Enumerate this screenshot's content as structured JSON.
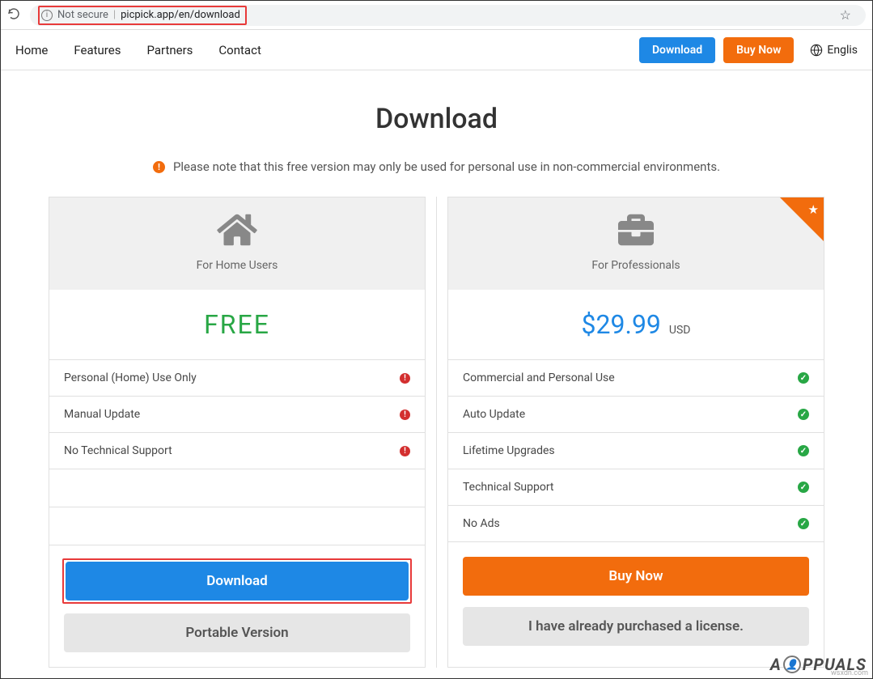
{
  "browser": {
    "security_label": "Not secure",
    "url": "picpick.app/en/download"
  },
  "nav": {
    "links": [
      "Home",
      "Features",
      "Partners",
      "Contact"
    ],
    "download": "Download",
    "buy": "Buy Now",
    "lang": "Englis"
  },
  "page": {
    "title": "Download",
    "notice": "Please note that this free version may only be used for personal use in non-commercial environments."
  },
  "free": {
    "head": "For Home Users",
    "price": "FREE",
    "features": [
      "Personal (Home) Use Only",
      "Manual Update",
      "No Technical Support"
    ],
    "download_btn": "Download",
    "portable_btn": "Portable Version"
  },
  "pro": {
    "head": "For Professionals",
    "price": "$29.99",
    "currency": "USD",
    "features": [
      "Commercial and Personal Use",
      "Auto Update",
      "Lifetime Upgrades",
      "Technical Support",
      "No Ads"
    ],
    "buy_btn": "Buy Now",
    "license_btn": "I have already purchased a license."
  },
  "watermark": {
    "brand": "PPUALS",
    "domain": "wsxdn.com"
  }
}
